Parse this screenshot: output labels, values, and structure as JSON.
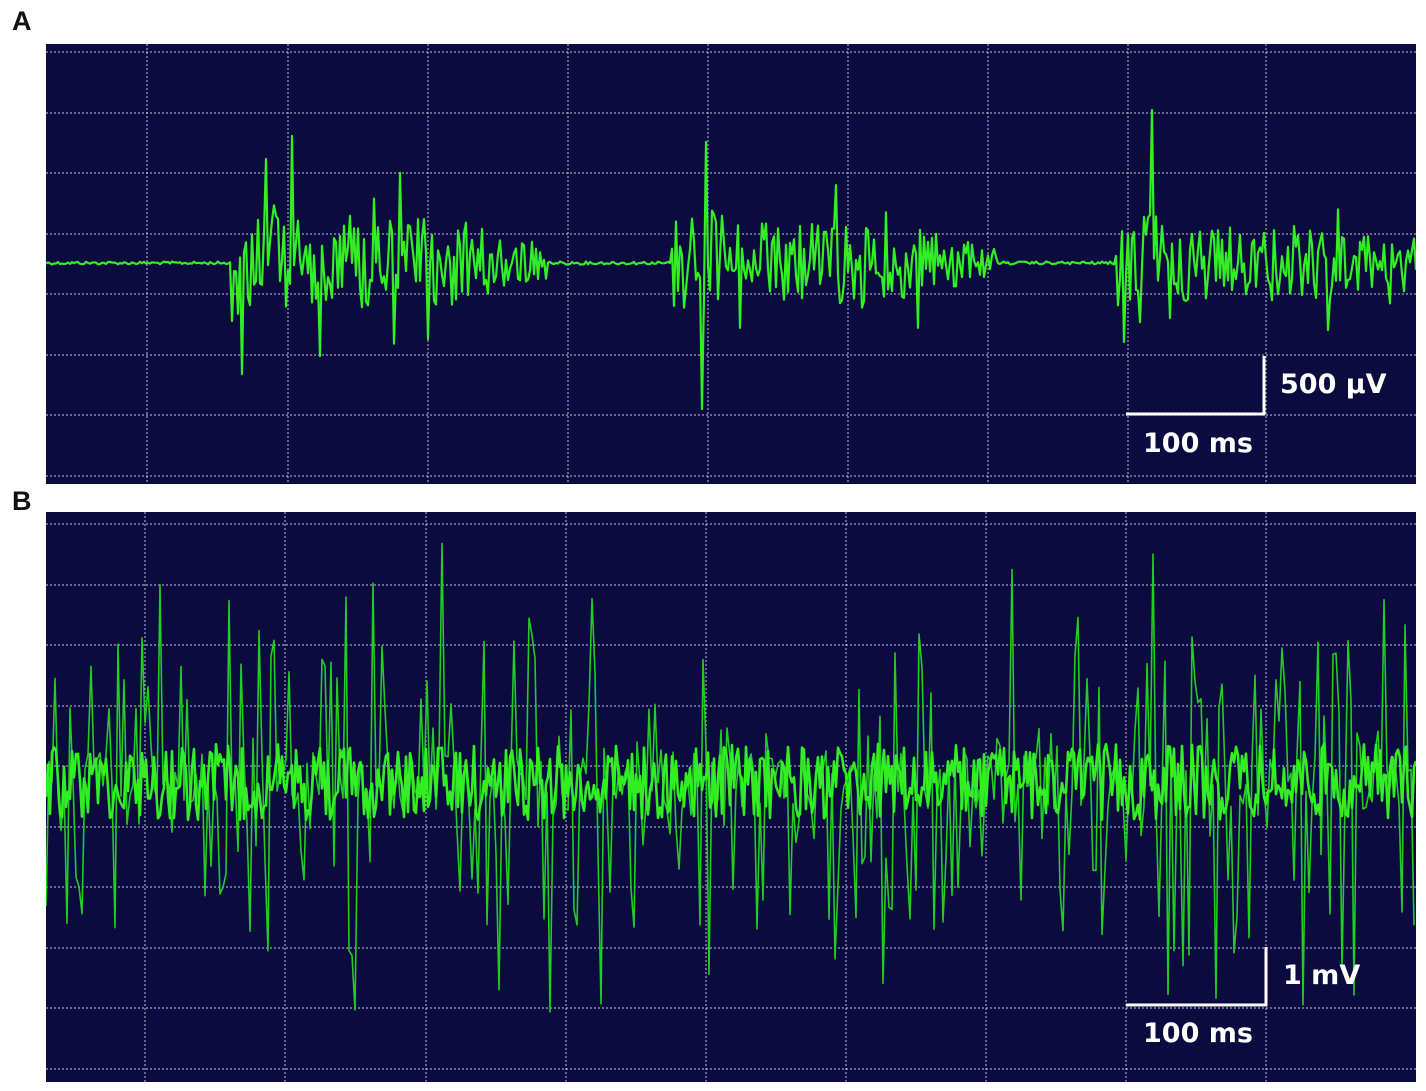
{
  "panels": [
    {
      "id": "A",
      "label": "A",
      "voltage_scale": "500 µV",
      "time_scale": "100 ms",
      "background_color": "#0b0b3f",
      "trace_color": "#33ee22",
      "grid_color": "#c8c8dc"
    },
    {
      "id": "B",
      "label": "B",
      "voltage_scale": "1 mV",
      "time_scale": "100 ms",
      "background_color": "#0b0b3f",
      "trace_color": "#22cc22",
      "grid_color": "#c8c8dc"
    }
  ]
}
